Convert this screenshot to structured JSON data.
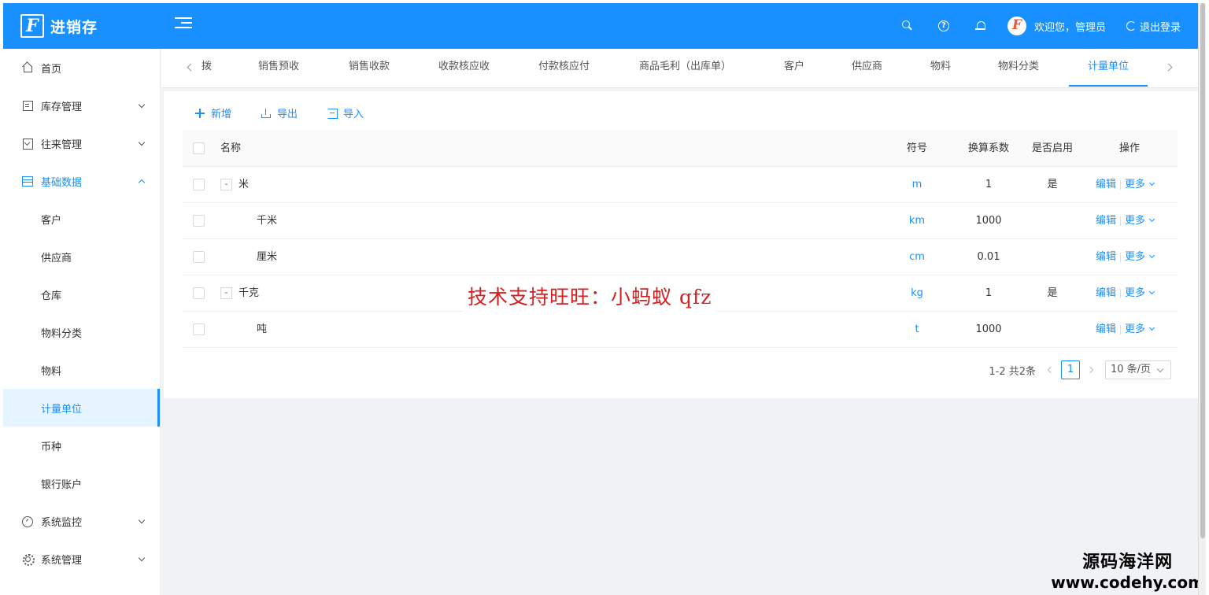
{
  "app": {
    "title": "进销存"
  },
  "header": {
    "welcome": "欢迎您，管理员",
    "logout": "退出登录"
  },
  "sidebar": {
    "items": [
      {
        "label": "首页"
      },
      {
        "label": "库存管理"
      },
      {
        "label": "往来管理"
      },
      {
        "label": "基础数据"
      },
      {
        "label": "客户"
      },
      {
        "label": "供应商"
      },
      {
        "label": "仓库"
      },
      {
        "label": "物料分类"
      },
      {
        "label": "物料"
      },
      {
        "label": "计量单位"
      },
      {
        "label": "币种"
      },
      {
        "label": "银行账户"
      },
      {
        "label": "系统监控"
      },
      {
        "label": "系统管理"
      }
    ]
  },
  "tabs": [
    {
      "label": "拨"
    },
    {
      "label": "销售预收"
    },
    {
      "label": "销售收款"
    },
    {
      "label": "收款核应收"
    },
    {
      "label": "付款核应付"
    },
    {
      "label": "商品毛利（出库单）"
    },
    {
      "label": "客户"
    },
    {
      "label": "供应商"
    },
    {
      "label": "物料"
    },
    {
      "label": "物料分类"
    },
    {
      "label": "计量单位"
    }
  ],
  "toolbar": {
    "add": "新增",
    "export": "导出",
    "import": "导入"
  },
  "table": {
    "columns": {
      "name": "名称",
      "symbol": "符号",
      "factor": "换算系数",
      "enabled": "是否启用",
      "ops": "操作"
    },
    "expand_symbol": "-",
    "rows": [
      {
        "name": "米",
        "symbol": "m",
        "factor": "1",
        "enabled": "是",
        "edit": "编辑",
        "more": "更多"
      },
      {
        "name": "千米",
        "symbol": "km",
        "factor": "1000",
        "enabled": "",
        "edit": "编辑",
        "more": "更多"
      },
      {
        "name": "厘米",
        "symbol": "cm",
        "factor": "0.01",
        "enabled": "",
        "edit": "编辑",
        "more": "更多"
      },
      {
        "name": "千克",
        "symbol": "kg",
        "factor": "1",
        "enabled": "是",
        "edit": "编辑",
        "more": "更多"
      },
      {
        "name": "吨",
        "symbol": "t",
        "factor": "1000",
        "enabled": "",
        "edit": "编辑",
        "more": "更多"
      }
    ]
  },
  "pagination": {
    "total_text": "1-2 共2条",
    "current_page": "1",
    "page_size": "10 条/页"
  },
  "overlay": {
    "watermark": "技术支持旺旺：小蚂蚁 qfz",
    "corner_line1": "源码海洋网",
    "corner_line2": "www.codehy.com"
  },
  "colors": {
    "primary": "#1890ff",
    "watermark": "#d42020",
    "content_bg": "#f0f2f5"
  }
}
